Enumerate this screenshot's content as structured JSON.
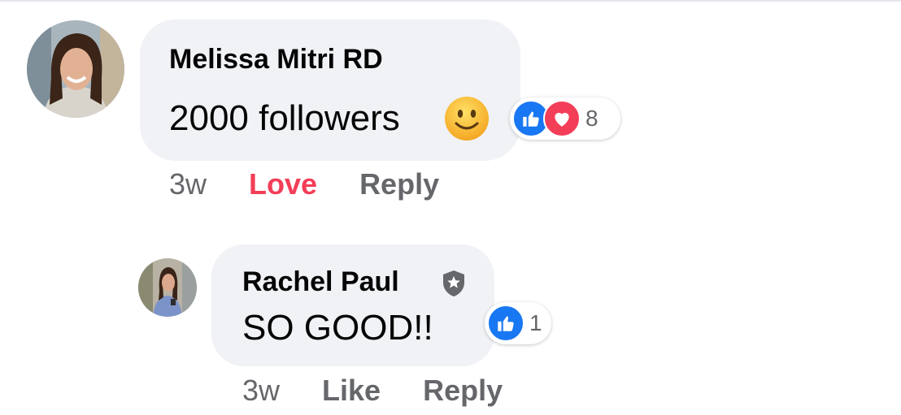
{
  "colors": {
    "bubble_bg": "#f0f2f5",
    "meta_text": "#65676b",
    "love_red": "#f33e58",
    "like_blue": "#1877f2"
  },
  "comments": [
    {
      "author": "Melissa Mitri RD",
      "text": "2000 followers",
      "emoji": "slightly-smiling-face",
      "reactions": {
        "icons": [
          "like-icon",
          "love-icon"
        ],
        "count": "8"
      },
      "time": "3w",
      "reaction_action": "Love",
      "reply_label": "Reply"
    },
    {
      "author": "Rachel Paul",
      "author_badge": "shield-star-icon",
      "text": "SO GOOD!!",
      "reactions": {
        "icons": [
          "like-icon"
        ],
        "count": "1"
      },
      "time": "3w",
      "reaction_action": "Like",
      "reply_label": "Reply"
    }
  ]
}
